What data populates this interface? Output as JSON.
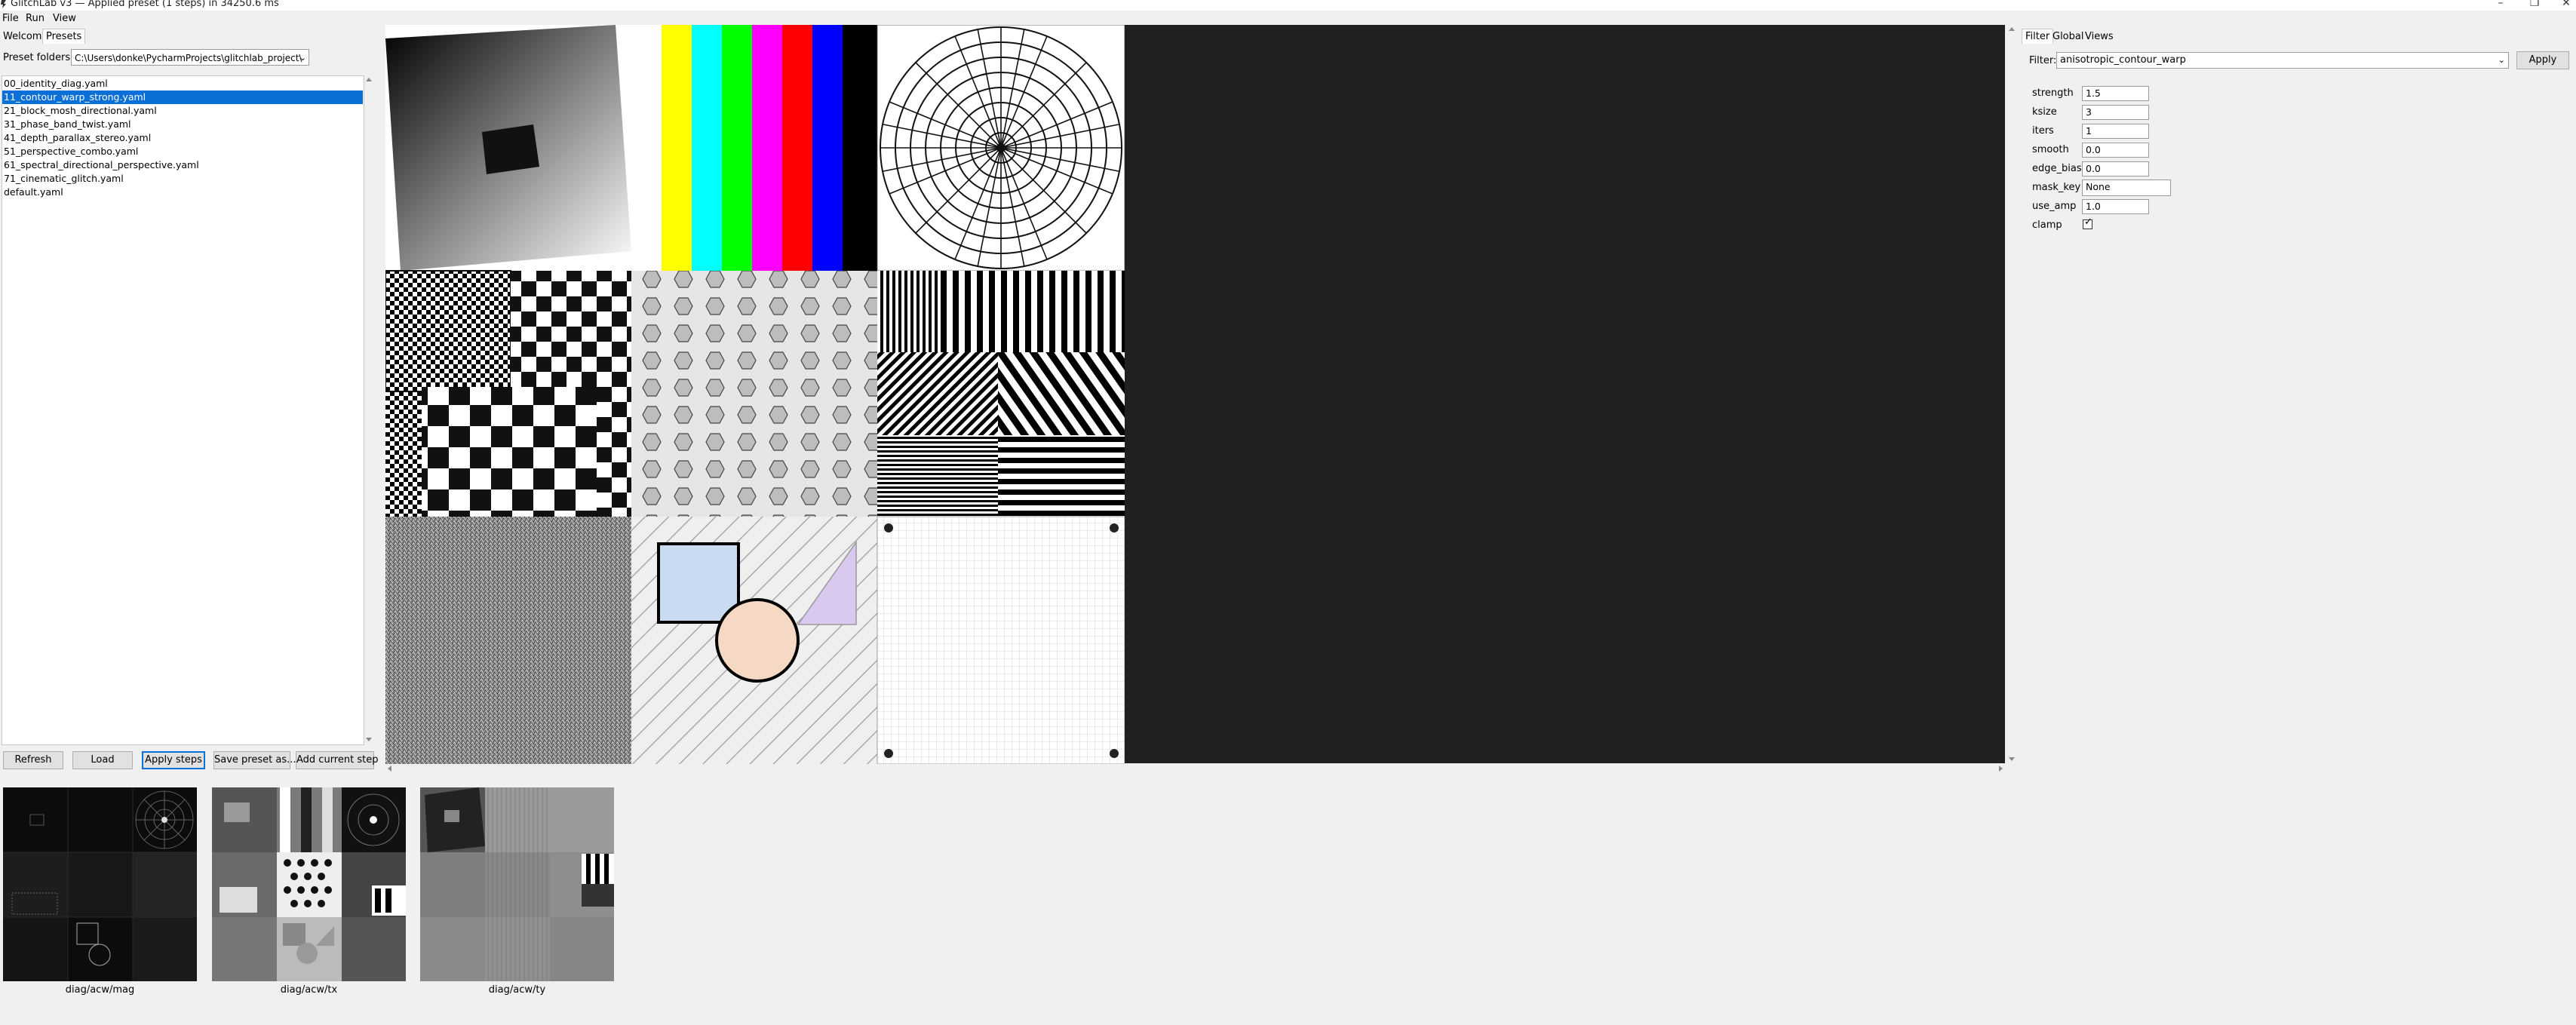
{
  "window": {
    "title": "GlitchLab v3 — Applied preset (1 steps) in 34250.6 ms",
    "minimize": "–",
    "maximize": "❐",
    "close": "✕"
  },
  "menu": [
    "File",
    "Run",
    "View"
  ],
  "main_tabs": [
    {
      "label": "Welcome"
    },
    {
      "label": "Presets"
    }
  ],
  "presets": {
    "folder_label": "Preset folders:",
    "folder_value": "C:\\Users\\donke\\PycharmProjects\\glitchlab_project\\",
    "items": [
      "00_identity_diag.yaml",
      "11_contour_warp_strong.yaml",
      "21_block_mosh_directional.yaml",
      "31_phase_band_twist.yaml",
      "41_depth_parallax_stereo.yaml",
      "51_perspective_combo.yaml",
      "61_spectral_directional_perspective.yaml",
      "71_cinematic_glitch.yaml",
      "default.yaml"
    ],
    "selected_index": 1,
    "buttons": [
      "Refresh",
      "Load",
      "Apply steps",
      "Save preset as...",
      "Add current step"
    ]
  },
  "right_tabs": [
    {
      "label": "Filter"
    },
    {
      "label": "Global"
    },
    {
      "label": "Views"
    }
  ],
  "filter": {
    "label": "Filter:",
    "value": "anisotropic_contour_warp",
    "apply": "Apply",
    "params": [
      {
        "name": "strength",
        "value": "1.5"
      },
      {
        "name": "ksize",
        "value": "3"
      },
      {
        "name": "iters",
        "value": "1"
      },
      {
        "name": "smooth",
        "value": "0.0"
      },
      {
        "name": "edge_bias",
        "value": "0.0"
      },
      {
        "name": "mask_key",
        "value": "None"
      },
      {
        "name": "use_amp",
        "value": "1.0"
      }
    ],
    "clamp": {
      "name": "clamp",
      "checked": true
    }
  },
  "thumbnails": [
    {
      "label": "diag/acw/mag"
    },
    {
      "label": "diag/acw/tx"
    },
    {
      "label": "diag/acw/ty"
    }
  ],
  "colors": {
    "selection": "#0a6fd6",
    "canvas_bg": "#202020",
    "panel_bg": "#f0f0f0"
  }
}
